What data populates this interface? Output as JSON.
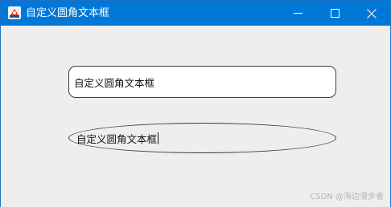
{
  "window": {
    "title": "自定义圆角文本框",
    "controls": {
      "minimize_icon": "minimize-icon",
      "maximize_icon": "maximize-icon",
      "close_icon": "close-icon"
    }
  },
  "textboxes": [
    {
      "value": "自定义圆角文本框",
      "shape": "rounded-rectangle"
    },
    {
      "value": "自定义圆角文本框",
      "shape": "ellipse",
      "focused": true
    }
  ],
  "watermark": "CSDN @海边漫步者",
  "colors": {
    "titlebar": "#0078d7",
    "background": "#eeeeee"
  }
}
